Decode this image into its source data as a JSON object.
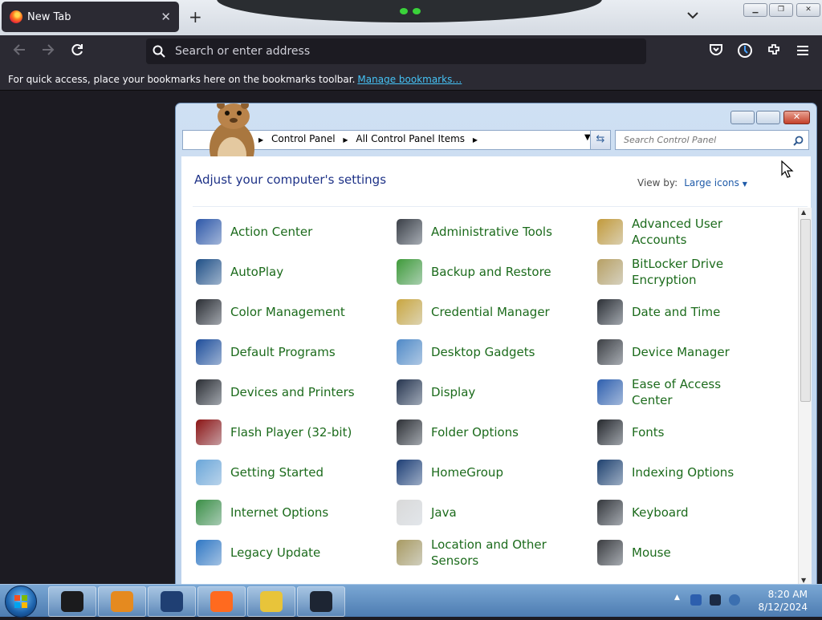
{
  "browser": {
    "tab_title": "New Tab",
    "tab_close": "✕",
    "new_tab": "+",
    "url_placeholder": "Search or enter address",
    "bookmarks_message": "For quick access, place your bookmarks here on the bookmarks toolbar.",
    "bookmarks_link": "Manage bookmarks…"
  },
  "control_panel": {
    "breadcrumb": [
      "Control Panel",
      "All Control Panel Items"
    ],
    "search_placeholder": "Search Control Panel",
    "heading": "Adjust your computer's settings",
    "view_by_label": "View by:",
    "view_by_value": "Large icons",
    "items": [
      {
        "label": "Action Center",
        "icon": "flag-shield-icon",
        "color": "#2d57a8"
      },
      {
        "label": "Administrative Tools",
        "icon": "admin-tools-icon",
        "color": "#3a3f47"
      },
      {
        "label": "Advanced User Accounts",
        "icon": "users-icon",
        "color": "#c29a3b"
      },
      {
        "label": "AutoPlay",
        "icon": "autoplay-icon",
        "color": "#1f4f86"
      },
      {
        "label": "Backup and Restore",
        "icon": "backup-icon",
        "color": "#3f9a3a"
      },
      {
        "label": "BitLocker Drive Encryption",
        "icon": "key-icon",
        "color": "#b7a064"
      },
      {
        "label": "Color Management",
        "icon": "monitor-color-icon",
        "color": "#2a2d33"
      },
      {
        "label": "Credential Manager",
        "icon": "vault-icon",
        "color": "#c9a640"
      },
      {
        "label": "Date and Time",
        "icon": "calendar-clock-icon",
        "color": "#2c3036"
      },
      {
        "label": "Default Programs",
        "icon": "default-programs-icon",
        "color": "#1d4d9a"
      },
      {
        "label": "Desktop Gadgets",
        "icon": "gadgets-icon",
        "color": "#4f89c7"
      },
      {
        "label": "Device Manager",
        "icon": "device-manager-icon",
        "color": "#3c3f44"
      },
      {
        "label": "Devices and Printers",
        "icon": "printer-icon",
        "color": "#2a2d33"
      },
      {
        "label": "Display",
        "icon": "display-icon",
        "color": "#26354f"
      },
      {
        "label": "Ease of Access Center",
        "icon": "accessibility-icon",
        "color": "#2e5fae"
      },
      {
        "label": "Flash Player (32-bit)",
        "icon": "flash-icon",
        "color": "#8b1414"
      },
      {
        "label": "Folder Options",
        "icon": "folder-options-icon",
        "color": "#2d3035"
      },
      {
        "label": "Fonts",
        "icon": "fonts-icon",
        "color": "#25282d"
      },
      {
        "label": "Getting Started",
        "icon": "getting-started-icon",
        "color": "#6aa6d9"
      },
      {
        "label": "HomeGroup",
        "icon": "homegroup-icon",
        "color": "#1d3e75"
      },
      {
        "label": "Indexing Options",
        "icon": "indexing-icon",
        "color": "#1e416f"
      },
      {
        "label": "Internet Options",
        "icon": "internet-options-icon",
        "color": "#3b8f46"
      },
      {
        "label": "Java",
        "icon": "java-icon",
        "color": "#d9d9d9"
      },
      {
        "label": "Keyboard",
        "icon": "keyboard-icon",
        "color": "#34373c"
      },
      {
        "label": "Legacy Update",
        "icon": "legacy-update-icon",
        "color": "#2f77c4"
      },
      {
        "label": "Location and Other Sensors",
        "icon": "sensors-icon",
        "color": "#a89a62"
      },
      {
        "label": "Mouse",
        "icon": "mouse-icon",
        "color": "#3a3c40"
      }
    ]
  },
  "taskbar": {
    "time": "8:20 AM",
    "date": "8/12/2024",
    "buttons": [
      {
        "name": "taskbar-app-1-icon",
        "color": "#1b1b1d"
      },
      {
        "name": "taskbar-media-player-icon",
        "color": "#e58a1f"
      },
      {
        "name": "taskbar-globe-icon",
        "color": "#1f3f73"
      },
      {
        "name": "taskbar-firefox-icon",
        "color": "#ff6a1f"
      },
      {
        "name": "taskbar-network-icon",
        "color": "#e8c43a"
      },
      {
        "name": "taskbar-control-panel-icon",
        "color": "#1d2533"
      }
    ]
  }
}
